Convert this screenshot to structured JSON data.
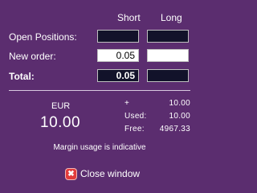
{
  "columns": {
    "short": "Short",
    "long": "Long"
  },
  "rows": {
    "open_positions": {
      "label": "Open Positions:",
      "short": "",
      "long": ""
    },
    "new_order": {
      "label": "New order:",
      "short": "0.05",
      "long": ""
    },
    "total": {
      "label": "Total:",
      "short": "0.05",
      "long": ""
    }
  },
  "currency": {
    "label": "EUR",
    "value": "10.00"
  },
  "stats": [
    {
      "label": "+",
      "value": "10.00"
    },
    {
      "label": "Used:",
      "value": "10.00"
    },
    {
      "label": "Free:",
      "value": "4967.33"
    }
  ],
  "note": "Margin usage is indicative",
  "close": {
    "icon": "close-icon",
    "label": "Close window",
    "icon_glyph": "✖"
  },
  "colors": {
    "background": "#5b2d6f",
    "dark_field": "#12122a",
    "close_icon": "#e23b3b"
  }
}
